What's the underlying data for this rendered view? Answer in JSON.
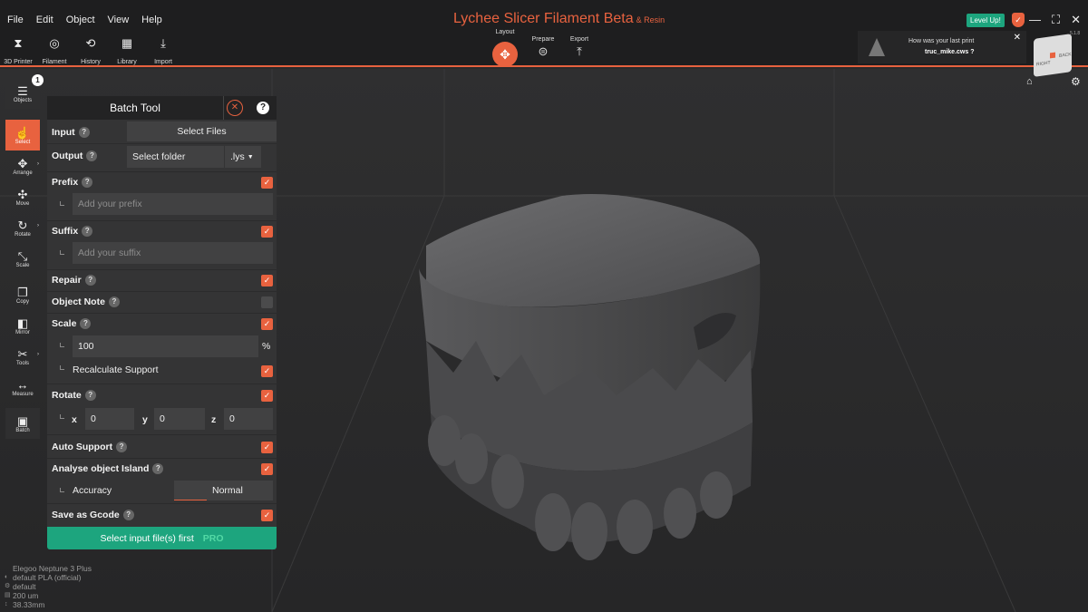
{
  "app": {
    "title": "Lychee Slicer Filament Beta",
    "title_suffix": "& Resin",
    "version": "5.1.8"
  },
  "menu": [
    "File",
    "Edit",
    "Object",
    "View",
    "Help"
  ],
  "toolbar": [
    {
      "label": "3D Printer",
      "icon": "printer-icon",
      "glyph": "⧗"
    },
    {
      "label": "Filament",
      "icon": "filament-icon",
      "glyph": "◎"
    },
    {
      "label": "History",
      "icon": "history-icon",
      "glyph": "⟲"
    },
    {
      "label": "Library",
      "icon": "library-icon",
      "glyph": "▦"
    },
    {
      "label": "Import",
      "icon": "import-icon",
      "glyph": "⤓"
    }
  ],
  "modes": {
    "layout": "Layout",
    "prepare": "Prepare",
    "export": "Export"
  },
  "level_up": "Level Up!",
  "notification": {
    "question": "How was your last print",
    "name": "truc_mike.cws ?"
  },
  "view_cube": {
    "right": "RIGHT",
    "back": "BACK"
  },
  "sidebar": {
    "objects": {
      "label": "Objects",
      "badge": "1"
    },
    "tools": [
      {
        "label": "Select",
        "icon": "select-hand-icon",
        "glyph": "☝",
        "active": true
      },
      {
        "label": "Arrange",
        "icon": "arrange-icon",
        "glyph": "✥"
      },
      {
        "label": "Move",
        "icon": "move-icon",
        "glyph": "✣"
      },
      {
        "label": "Rotate",
        "icon": "rotate-icon",
        "glyph": "↻"
      },
      {
        "label": "Scale",
        "icon": "scale-icon",
        "glyph": "⤡"
      },
      {
        "label": "Copy",
        "icon": "copy-icon",
        "glyph": "❐"
      },
      {
        "label": "Mirror",
        "icon": "mirror-icon",
        "glyph": "◧"
      },
      {
        "label": "Tools",
        "icon": "tools-scissors-icon",
        "glyph": "✂"
      },
      {
        "label": "Measure",
        "icon": "measure-icon",
        "glyph": "↔"
      },
      {
        "label": "Batch",
        "icon": "batch-icon",
        "glyph": "▣"
      }
    ]
  },
  "batch": {
    "title": "Batch Tool",
    "input_label": "Input",
    "select_files": "Select Files",
    "output_label": "Output",
    "select_folder": "Select folder",
    "format": ".lys",
    "prefix_label": "Prefix",
    "prefix_placeholder": "Add your prefix",
    "suffix_label": "Suffix",
    "suffix_placeholder": "Add your suffix",
    "repair_label": "Repair",
    "object_note_label": "Object Note",
    "scale_label": "Scale",
    "scale_value": "100",
    "scale_unit": "%",
    "recalc_label": "Recalculate Support",
    "rotate_label": "Rotate",
    "rotate": {
      "x_label": "x",
      "x": "0",
      "y_label": "y",
      "y": "0",
      "z_label": "z",
      "z": "0"
    },
    "auto_support_label": "Auto Support",
    "island_label": "Analyse object Island",
    "accuracy_label": "Accuracy",
    "accuracy_value": "Normal",
    "gcode_label": "Save as Gcode",
    "action": "Select input file(s) first",
    "pro": "PRO",
    "checked": {
      "prefix": true,
      "suffix": true,
      "repair": true,
      "object_note": false,
      "scale": true,
      "recalc": true,
      "rotate": true,
      "auto_support": true,
      "island": true,
      "gcode": true
    }
  },
  "status": [
    "Elegoo Neptune 3 Plus",
    "default PLA (official)",
    "default",
    "200 um",
    "38.33mm"
  ],
  "colors": {
    "accent": "#e8623f",
    "green": "#1da57e",
    "panel": "#343435",
    "viewport": "#2a2a2b"
  }
}
